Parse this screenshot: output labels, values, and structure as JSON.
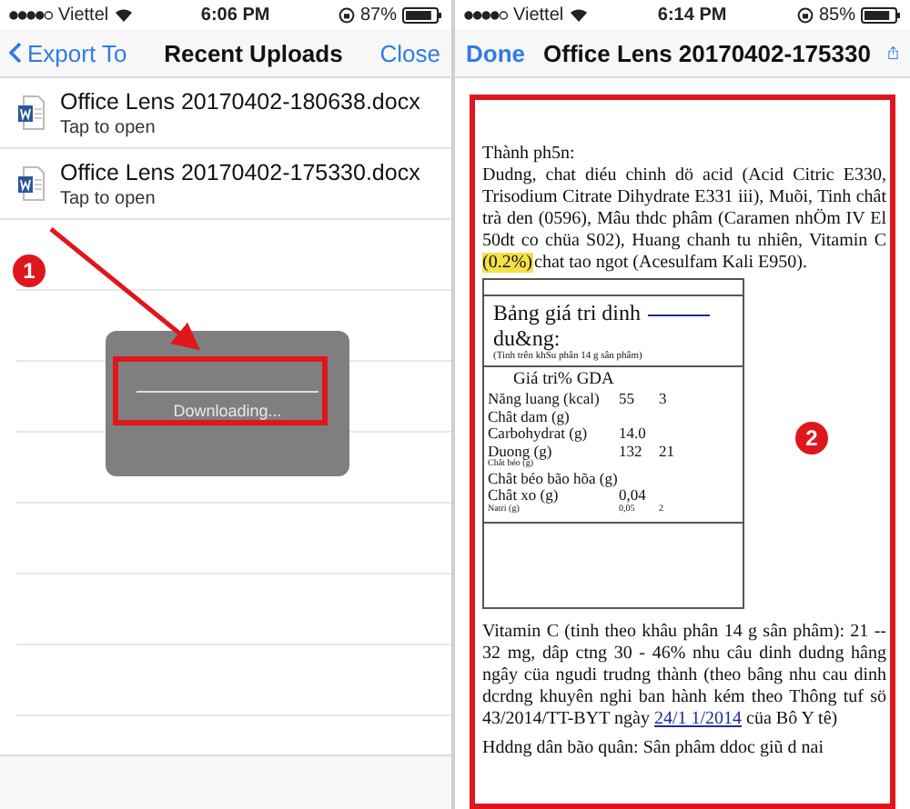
{
  "left_screen": {
    "status_bar": {
      "carrier": "Viettel",
      "time": "6:06 PM",
      "battery": "87%"
    },
    "nav": {
      "back": "Export To",
      "title": "Recent Uploads",
      "action": "Close"
    },
    "files": [
      {
        "name": "Office Lens 20170402-180638.docx",
        "subtitle": "Tap to open"
      },
      {
        "name": "Office Lens 20170402-175330.docx",
        "subtitle": "Tap to open"
      }
    ],
    "hud": {
      "message": "Downloading..."
    }
  },
  "right_screen": {
    "status_bar": {
      "carrier": "Viettel",
      "time": "6:14 PM",
      "battery": "85%"
    },
    "nav": {
      "done": "Done",
      "title": "Office Lens 20170402-175330"
    },
    "document": {
      "heading": "Thành ph5n:",
      "ingredients": {
        "before": "Dudng, chat diéu chinh dö acid (Acid Citric E330, Trisodium Citrate Dihydrate E331 iii), Muõi, Tinh chât trà den (0596), Mâu thdc phâm (Caramen nhÖm IV El 50dt co chüa S02), Huang chanh tu nhiên, Vitamin C ",
        "highlight": "(0.2%)",
        "after": "chat tao ngot (Acesulfam Kali E950)."
      },
      "nutrition_table": {
        "title": "Bảng giá tri dinh",
        "title_line2": "du&ng:",
        "serving": "(Tinh trên khSu phân 14 g sân phâm)",
        "column_header": "Giá tri% GDA",
        "rows": [
          {
            "kind": "normal",
            "cells": [
              "Năng luang (kcal)",
              "55",
              "3"
            ]
          },
          {
            "kind": "normal",
            "cells": [
              "Chât dam (g)"
            ]
          },
          {
            "kind": "normal",
            "cells": [
              "Carbohydrat (g)",
              "14.0"
            ]
          },
          {
            "kind": "normal",
            "cells": [
              "Duong (g)",
              "132",
              "21"
            ]
          },
          {
            "kind": "small",
            "cells": [
              "Chât béo (g)"
            ]
          },
          {
            "kind": "normal",
            "cells": [
              "Chât béo bão hõa (g)"
            ]
          },
          {
            "kind": "normal",
            "cells": [
              "Chât xo (g)",
              "0,04"
            ]
          },
          {
            "kind": "small",
            "cells": [
              "Natri (g)",
              "0,05",
              "2"
            ]
          }
        ]
      },
      "vitamin_note": {
        "before": "Vitamin C (tinh theo khâu phân 14 g sân phâm): 21 -- 32 mg, dâp ctng 30 - 46% nhu câu dinh dudng hâng ngây cüa ngudi trudng thành (theo bâng nhu cau dinh dcrdng khuyên nghi ban hành kém theo Thông tuf sö 43/2014/TT-BYT ngày ",
        "link": "24/1 1/2014",
        "after": " cüa Bô Y tê)"
      },
      "storage_note": "Hddng dân bão quân: Sân phâm ddoc giũ d nai"
    }
  },
  "annotations": [
    {
      "label": "1"
    },
    {
      "label": "2"
    }
  ]
}
